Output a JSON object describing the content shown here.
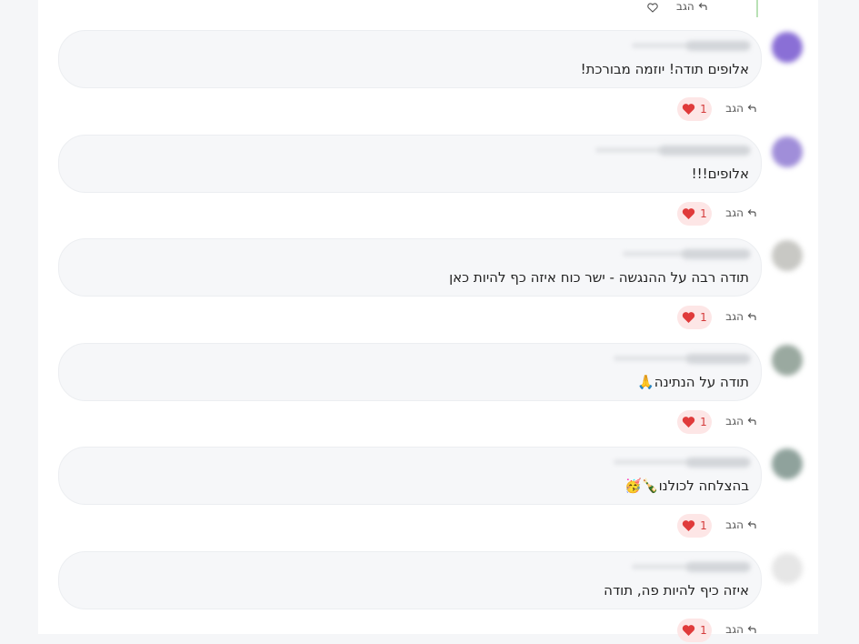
{
  "top_reply_label": "הגב",
  "comments": [
    {
      "text": "אלופים תודה! יוזמה מבורכת!",
      "likes": "1",
      "reply_label": "הגב",
      "avatar_color": "#8a6fd6"
    },
    {
      "text": "אלופים!!!",
      "likes": "1",
      "reply_label": "הגב",
      "avatar_color": "#a08ed9"
    },
    {
      "text": "תודה רבה על ההנגשה - ישר כוח איזה כף להיות כאן",
      "likes": "1",
      "reply_label": "הגב",
      "avatar_color": "#c8c8c4"
    },
    {
      "text": "תודה על הנתינה🙏",
      "likes": "1",
      "reply_label": "הגב",
      "avatar_color": "#9aa9a0"
    },
    {
      "text": "בהצלחה לכולנו🍾🥳",
      "likes": "1",
      "reply_label": "הגב",
      "avatar_color": "#8fa29c"
    },
    {
      "text": "איזה כיף להיות פה, תודה",
      "likes": "1",
      "reply_label": "הגב",
      "avatar_color": "#e6e6e6"
    }
  ],
  "colors": {
    "like_bg": "#fde6e6",
    "like_heart": "#e03b3b",
    "bubble_bg": "#f6f7f9"
  },
  "icons": {
    "reply": "reply-arrow-icon",
    "like": "heart-icon",
    "like_outline": "heart-outline-icon"
  }
}
